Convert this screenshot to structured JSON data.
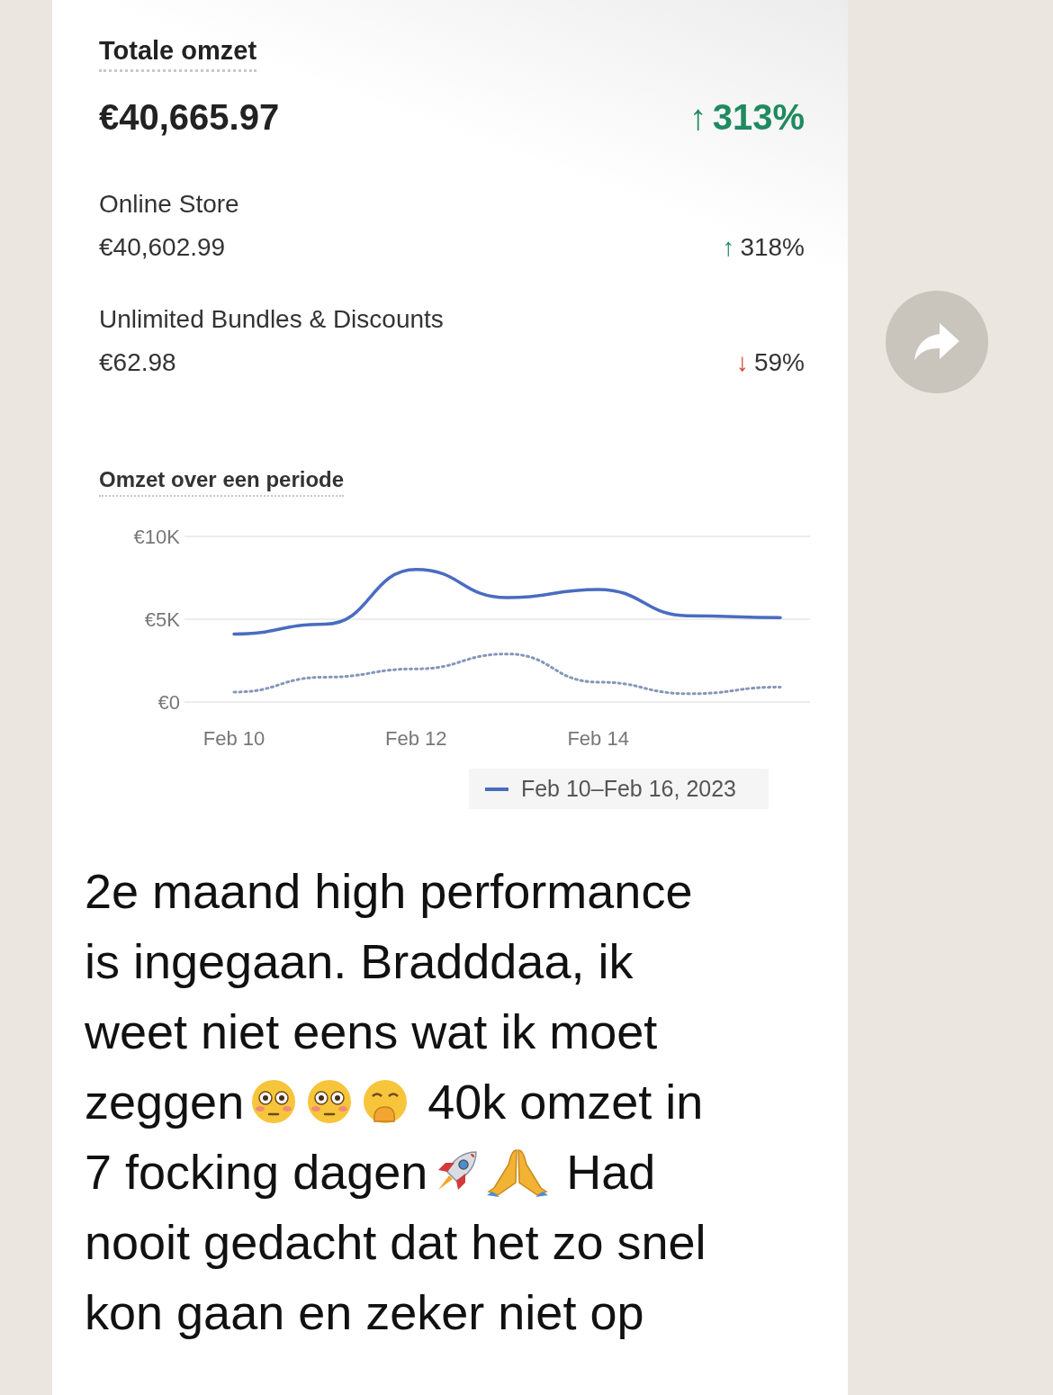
{
  "summary": {
    "title": "Totale omzet",
    "total": "€40,665.97",
    "arrow": "↑",
    "change": "313%",
    "color": "#1f8a5f"
  },
  "channels": [
    {
      "name": "Online Store",
      "amount": "€40,602.99",
      "arrow": "↑",
      "change": "318%",
      "color": "#1f8a5f"
    },
    {
      "name": "Unlimited Bundles & Discounts",
      "amount": "€62.98",
      "arrow": "↓",
      "change": "59%",
      "color": "#d0412b"
    }
  ],
  "chart": {
    "title": "Omzet over een periode",
    "chart_data": {
      "type": "line",
      "categories": [
        "Feb 10",
        null,
        "Feb 12",
        null,
        "Feb 14",
        null,
        null
      ],
      "ylim": [
        0,
        10000
      ],
      "yticks": [
        {
          "value": 0,
          "label": "€0"
        },
        {
          "value": 5000,
          "label": "€5K"
        },
        {
          "value": 10000,
          "label": "€10K"
        }
      ],
      "series": [
        {
          "name": "Feb 10–Feb 16, 2023",
          "color": "#4a6cc0",
          "values": [
            4100,
            4700,
            8000,
            6300,
            6800,
            5200,
            5100
          ]
        },
        {
          "color": "#8596b8",
          "line_style": "dotted",
          "values": [
            600,
            1500,
            2000,
            2900,
            1200,
            500,
            900
          ]
        }
      ]
    }
  },
  "message": [
    {
      "segments": [
        {
          "kind": "text",
          "text": "2e maand high performance"
        }
      ]
    },
    {
      "segments": [
        {
          "kind": "text",
          "text": "is ingegaan. Bradddaa, ik"
        }
      ]
    },
    {
      "segments": [
        {
          "kind": "text",
          "text": "weet niet eens wat ik moet"
        }
      ]
    },
    {
      "segments": [
        {
          "kind": "text",
          "text": "zeggen"
        },
        {
          "kind": "flushed"
        },
        {
          "kind": "flushed"
        },
        {
          "kind": "hand-over-mouth"
        },
        {
          "kind": "text",
          "text": "40k omzet in"
        }
      ]
    },
    {
      "segments": [
        {
          "kind": "text",
          "text": "7 focking dagen"
        },
        {
          "kind": "rocket"
        },
        {
          "kind": "folded-hands"
        },
        {
          "kind": "text",
          "text": "Had"
        }
      ]
    },
    {
      "segments": [
        {
          "kind": "text",
          "text": "nooit gedacht dat het zo snel"
        }
      ]
    },
    {
      "segments": [
        {
          "kind": "text",
          "text": "kon gaan en zeker niet op"
        }
      ]
    }
  ]
}
